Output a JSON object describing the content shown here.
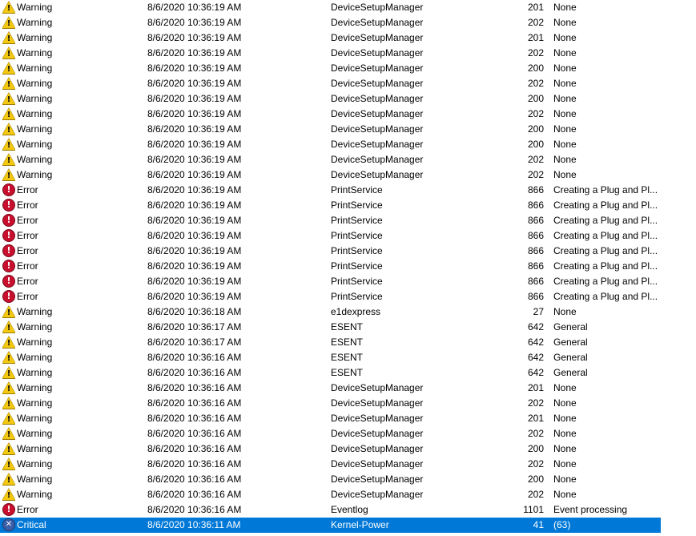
{
  "colors": {
    "selection": "#0078d7",
    "warning": "#f2c811",
    "error": "#c8102e",
    "critical": "#3b5fa8"
  },
  "icons": {
    "Warning": "warning-icon",
    "Error": "error-icon",
    "Critical": "critical-icon"
  },
  "events": [
    {
      "level": "Warning",
      "date": "8/6/2020 10:36:19 AM",
      "source": "DeviceSetupManager",
      "id": "201",
      "task": "None"
    },
    {
      "level": "Warning",
      "date": "8/6/2020 10:36:19 AM",
      "source": "DeviceSetupManager",
      "id": "202",
      "task": "None"
    },
    {
      "level": "Warning",
      "date": "8/6/2020 10:36:19 AM",
      "source": "DeviceSetupManager",
      "id": "201",
      "task": "None"
    },
    {
      "level": "Warning",
      "date": "8/6/2020 10:36:19 AM",
      "source": "DeviceSetupManager",
      "id": "202",
      "task": "None"
    },
    {
      "level": "Warning",
      "date": "8/6/2020 10:36:19 AM",
      "source": "DeviceSetupManager",
      "id": "200",
      "task": "None"
    },
    {
      "level": "Warning",
      "date": "8/6/2020 10:36:19 AM",
      "source": "DeviceSetupManager",
      "id": "202",
      "task": "None"
    },
    {
      "level": "Warning",
      "date": "8/6/2020 10:36:19 AM",
      "source": "DeviceSetupManager",
      "id": "200",
      "task": "None"
    },
    {
      "level": "Warning",
      "date": "8/6/2020 10:36:19 AM",
      "source": "DeviceSetupManager",
      "id": "202",
      "task": "None"
    },
    {
      "level": "Warning",
      "date": "8/6/2020 10:36:19 AM",
      "source": "DeviceSetupManager",
      "id": "200",
      "task": "None"
    },
    {
      "level": "Warning",
      "date": "8/6/2020 10:36:19 AM",
      "source": "DeviceSetupManager",
      "id": "200",
      "task": "None"
    },
    {
      "level": "Warning",
      "date": "8/6/2020 10:36:19 AM",
      "source": "DeviceSetupManager",
      "id": "202",
      "task": "None"
    },
    {
      "level": "Warning",
      "date": "8/6/2020 10:36:19 AM",
      "source": "DeviceSetupManager",
      "id": "202",
      "task": "None"
    },
    {
      "level": "Error",
      "date": "8/6/2020 10:36:19 AM",
      "source": "PrintService",
      "id": "866",
      "task": "Creating a Plug and Pl..."
    },
    {
      "level": "Error",
      "date": "8/6/2020 10:36:19 AM",
      "source": "PrintService",
      "id": "866",
      "task": "Creating a Plug and Pl..."
    },
    {
      "level": "Error",
      "date": "8/6/2020 10:36:19 AM",
      "source": "PrintService",
      "id": "866",
      "task": "Creating a Plug and Pl..."
    },
    {
      "level": "Error",
      "date": "8/6/2020 10:36:19 AM",
      "source": "PrintService",
      "id": "866",
      "task": "Creating a Plug and Pl..."
    },
    {
      "level": "Error",
      "date": "8/6/2020 10:36:19 AM",
      "source": "PrintService",
      "id": "866",
      "task": "Creating a Plug and Pl..."
    },
    {
      "level": "Error",
      "date": "8/6/2020 10:36:19 AM",
      "source": "PrintService",
      "id": "866",
      "task": "Creating a Plug and Pl..."
    },
    {
      "level": "Error",
      "date": "8/6/2020 10:36:19 AM",
      "source": "PrintService",
      "id": "866",
      "task": "Creating a Plug and Pl..."
    },
    {
      "level": "Error",
      "date": "8/6/2020 10:36:19 AM",
      "source": "PrintService",
      "id": "866",
      "task": "Creating a Plug and Pl..."
    },
    {
      "level": "Warning",
      "date": "8/6/2020 10:36:18 AM",
      "source": "e1dexpress",
      "id": "27",
      "task": "None"
    },
    {
      "level": "Warning",
      "date": "8/6/2020 10:36:17 AM",
      "source": "ESENT",
      "id": "642",
      "task": "General"
    },
    {
      "level": "Warning",
      "date": "8/6/2020 10:36:17 AM",
      "source": "ESENT",
      "id": "642",
      "task": "General"
    },
    {
      "level": "Warning",
      "date": "8/6/2020 10:36:16 AM",
      "source": "ESENT",
      "id": "642",
      "task": "General"
    },
    {
      "level": "Warning",
      "date": "8/6/2020 10:36:16 AM",
      "source": "ESENT",
      "id": "642",
      "task": "General"
    },
    {
      "level": "Warning",
      "date": "8/6/2020 10:36:16 AM",
      "source": "DeviceSetupManager",
      "id": "201",
      "task": "None"
    },
    {
      "level": "Warning",
      "date": "8/6/2020 10:36:16 AM",
      "source": "DeviceSetupManager",
      "id": "202",
      "task": "None"
    },
    {
      "level": "Warning",
      "date": "8/6/2020 10:36:16 AM",
      "source": "DeviceSetupManager",
      "id": "201",
      "task": "None"
    },
    {
      "level": "Warning",
      "date": "8/6/2020 10:36:16 AM",
      "source": "DeviceSetupManager",
      "id": "202",
      "task": "None"
    },
    {
      "level": "Warning",
      "date": "8/6/2020 10:36:16 AM",
      "source": "DeviceSetupManager",
      "id": "200",
      "task": "None"
    },
    {
      "level": "Warning",
      "date": "8/6/2020 10:36:16 AM",
      "source": "DeviceSetupManager",
      "id": "202",
      "task": "None"
    },
    {
      "level": "Warning",
      "date": "8/6/2020 10:36:16 AM",
      "source": "DeviceSetupManager",
      "id": "200",
      "task": "None"
    },
    {
      "level": "Warning",
      "date": "8/6/2020 10:36:16 AM",
      "source": "DeviceSetupManager",
      "id": "202",
      "task": "None"
    },
    {
      "level": "Error",
      "date": "8/6/2020 10:36:16 AM",
      "source": "Eventlog",
      "id": "1101",
      "task": "Event processing"
    },
    {
      "level": "Critical",
      "date": "8/6/2020 10:36:11 AM",
      "source": "Kernel-Power",
      "id": "41",
      "task": "(63)",
      "selected": true
    }
  ]
}
